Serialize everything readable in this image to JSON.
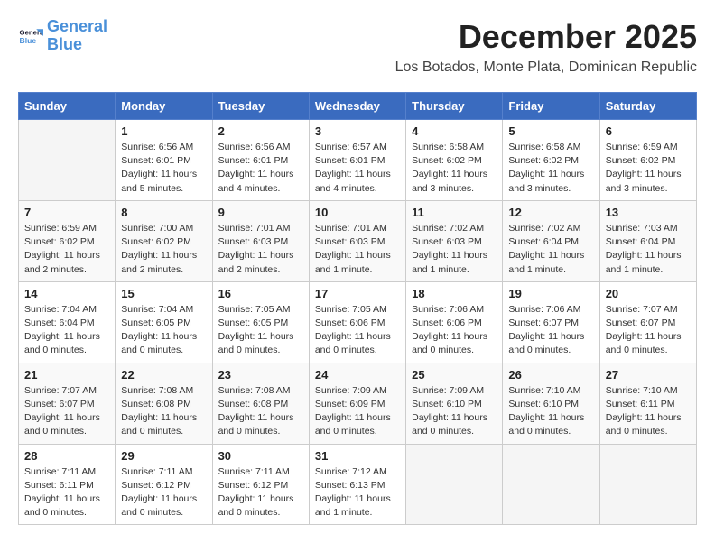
{
  "logo": {
    "line1": "General",
    "line2": "Blue"
  },
  "title": "December 2025",
  "location": "Los Botados, Monte Plata, Dominican Republic",
  "weekdays": [
    "Sunday",
    "Monday",
    "Tuesday",
    "Wednesday",
    "Thursday",
    "Friday",
    "Saturday"
  ],
  "weeks": [
    [
      {
        "day": "",
        "info": ""
      },
      {
        "day": "1",
        "info": "Sunrise: 6:56 AM\nSunset: 6:01 PM\nDaylight: 11 hours\nand 5 minutes."
      },
      {
        "day": "2",
        "info": "Sunrise: 6:56 AM\nSunset: 6:01 PM\nDaylight: 11 hours\nand 4 minutes."
      },
      {
        "day": "3",
        "info": "Sunrise: 6:57 AM\nSunset: 6:01 PM\nDaylight: 11 hours\nand 4 minutes."
      },
      {
        "day": "4",
        "info": "Sunrise: 6:58 AM\nSunset: 6:02 PM\nDaylight: 11 hours\nand 3 minutes."
      },
      {
        "day": "5",
        "info": "Sunrise: 6:58 AM\nSunset: 6:02 PM\nDaylight: 11 hours\nand 3 minutes."
      },
      {
        "day": "6",
        "info": "Sunrise: 6:59 AM\nSunset: 6:02 PM\nDaylight: 11 hours\nand 3 minutes."
      }
    ],
    [
      {
        "day": "7",
        "info": "Sunrise: 6:59 AM\nSunset: 6:02 PM\nDaylight: 11 hours\nand 2 minutes."
      },
      {
        "day": "8",
        "info": "Sunrise: 7:00 AM\nSunset: 6:02 PM\nDaylight: 11 hours\nand 2 minutes."
      },
      {
        "day": "9",
        "info": "Sunrise: 7:01 AM\nSunset: 6:03 PM\nDaylight: 11 hours\nand 2 minutes."
      },
      {
        "day": "10",
        "info": "Sunrise: 7:01 AM\nSunset: 6:03 PM\nDaylight: 11 hours\nand 1 minute."
      },
      {
        "day": "11",
        "info": "Sunrise: 7:02 AM\nSunset: 6:03 PM\nDaylight: 11 hours\nand 1 minute."
      },
      {
        "day": "12",
        "info": "Sunrise: 7:02 AM\nSunset: 6:04 PM\nDaylight: 11 hours\nand 1 minute."
      },
      {
        "day": "13",
        "info": "Sunrise: 7:03 AM\nSunset: 6:04 PM\nDaylight: 11 hours\nand 1 minute."
      }
    ],
    [
      {
        "day": "14",
        "info": "Sunrise: 7:04 AM\nSunset: 6:04 PM\nDaylight: 11 hours\nand 0 minutes."
      },
      {
        "day": "15",
        "info": "Sunrise: 7:04 AM\nSunset: 6:05 PM\nDaylight: 11 hours\nand 0 minutes."
      },
      {
        "day": "16",
        "info": "Sunrise: 7:05 AM\nSunset: 6:05 PM\nDaylight: 11 hours\nand 0 minutes."
      },
      {
        "day": "17",
        "info": "Sunrise: 7:05 AM\nSunset: 6:06 PM\nDaylight: 11 hours\nand 0 minutes."
      },
      {
        "day": "18",
        "info": "Sunrise: 7:06 AM\nSunset: 6:06 PM\nDaylight: 11 hours\nand 0 minutes."
      },
      {
        "day": "19",
        "info": "Sunrise: 7:06 AM\nSunset: 6:07 PM\nDaylight: 11 hours\nand 0 minutes."
      },
      {
        "day": "20",
        "info": "Sunrise: 7:07 AM\nSunset: 6:07 PM\nDaylight: 11 hours\nand 0 minutes."
      }
    ],
    [
      {
        "day": "21",
        "info": "Sunrise: 7:07 AM\nSunset: 6:07 PM\nDaylight: 11 hours\nand 0 minutes."
      },
      {
        "day": "22",
        "info": "Sunrise: 7:08 AM\nSunset: 6:08 PM\nDaylight: 11 hours\nand 0 minutes."
      },
      {
        "day": "23",
        "info": "Sunrise: 7:08 AM\nSunset: 6:08 PM\nDaylight: 11 hours\nand 0 minutes."
      },
      {
        "day": "24",
        "info": "Sunrise: 7:09 AM\nSunset: 6:09 PM\nDaylight: 11 hours\nand 0 minutes."
      },
      {
        "day": "25",
        "info": "Sunrise: 7:09 AM\nSunset: 6:10 PM\nDaylight: 11 hours\nand 0 minutes."
      },
      {
        "day": "26",
        "info": "Sunrise: 7:10 AM\nSunset: 6:10 PM\nDaylight: 11 hours\nand 0 minutes."
      },
      {
        "day": "27",
        "info": "Sunrise: 7:10 AM\nSunset: 6:11 PM\nDaylight: 11 hours\nand 0 minutes."
      }
    ],
    [
      {
        "day": "28",
        "info": "Sunrise: 7:11 AM\nSunset: 6:11 PM\nDaylight: 11 hours\nand 0 minutes."
      },
      {
        "day": "29",
        "info": "Sunrise: 7:11 AM\nSunset: 6:12 PM\nDaylight: 11 hours\nand 0 minutes."
      },
      {
        "day": "30",
        "info": "Sunrise: 7:11 AM\nSunset: 6:12 PM\nDaylight: 11 hours\nand 0 minutes."
      },
      {
        "day": "31",
        "info": "Sunrise: 7:12 AM\nSunset: 6:13 PM\nDaylight: 11 hours\nand 1 minute."
      },
      {
        "day": "",
        "info": ""
      },
      {
        "day": "",
        "info": ""
      },
      {
        "day": "",
        "info": ""
      }
    ]
  ]
}
